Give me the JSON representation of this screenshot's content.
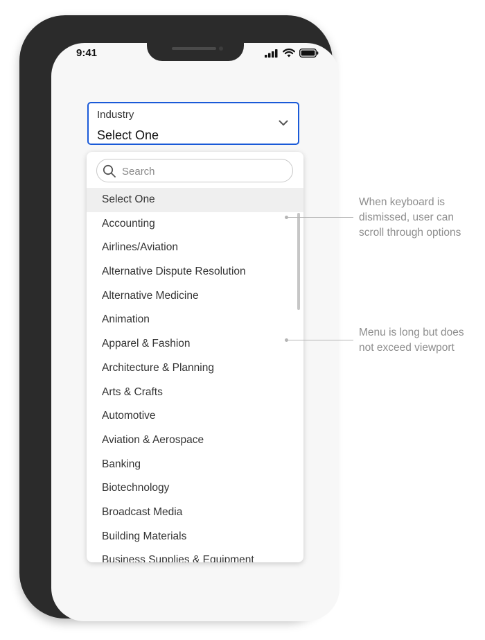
{
  "status_bar": {
    "time": "9:41",
    "icons": [
      "signal-icon",
      "wifi-icon",
      "battery-icon"
    ]
  },
  "dropdown": {
    "label": "Industry",
    "value": "Select One",
    "accent_color": "#1a5ad8"
  },
  "menu": {
    "search_placeholder": "Search",
    "selected_index": 0,
    "options": [
      "Select One",
      "Accounting",
      "Airlines/Aviation",
      "Alternative Dispute Resolution",
      "Alternative Medicine",
      "Animation",
      "Apparel & Fashion",
      "Architecture & Planning",
      "Arts & Crafts",
      "Automotive",
      "Aviation & Aerospace",
      "Banking",
      "Biotechnology",
      "Broadcast Media",
      "Building Materials",
      "Business Supplies & Equipment"
    ]
  },
  "annotations": [
    {
      "text": "When keyboard is\ndismissed, user can\nscroll through options"
    },
    {
      "text": "Menu is long but does\nnot exceed viewport"
    }
  ]
}
